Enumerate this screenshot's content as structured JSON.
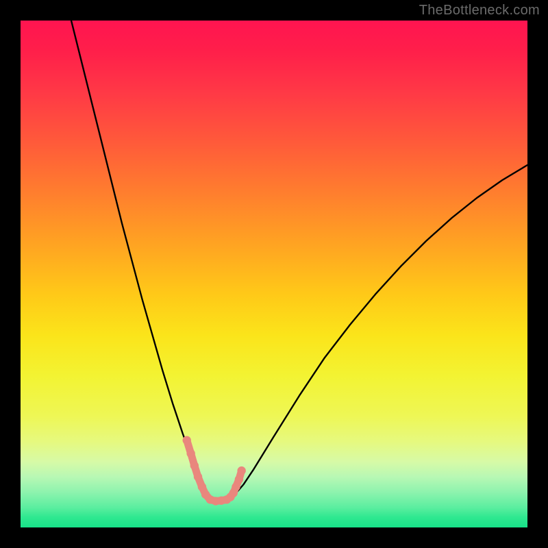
{
  "watermark": "TheBottleneck.com",
  "chart_data": {
    "type": "line",
    "title": "",
    "xlabel": "",
    "ylabel": "",
    "xlim": [
      0,
      100
    ],
    "ylim": [
      0,
      100
    ],
    "grid": false,
    "series": [
      {
        "name": "bottleneck-curve",
        "color": "#000000",
        "x": [
          10,
          12,
          14,
          16,
          18,
          20,
          22,
          24,
          26,
          28,
          30,
          32,
          34,
          36,
          37.4,
          40.7,
          42,
          44,
          46,
          50,
          55,
          60,
          65,
          70,
          75,
          80,
          85,
          90,
          95,
          100
        ],
        "y": [
          100,
          92,
          84,
          76,
          68,
          60,
          52.5,
          45,
          38,
          31,
          24.5,
          18.5,
          13,
          8,
          5.5,
          5.5,
          6.2,
          8.5,
          11.5,
          18,
          26,
          33.5,
          40,
          46,
          51.5,
          56.5,
          61,
          65,
          68.5,
          71.5
        ]
      },
      {
        "name": "bottleneck-marker-band",
        "color": "#e9877d",
        "x": [
          32.8,
          33.6,
          34.3,
          35.0,
          35.8,
          36.5,
          37.4,
          38.5,
          39.6,
          40.7,
          41.4,
          42.0,
          42.5,
          43.1,
          43.6
        ],
        "y": [
          17.2,
          14.6,
          12.2,
          10.0,
          8.0,
          6.5,
          5.5,
          5.2,
          5.3,
          5.5,
          6.0,
          6.8,
          8.0,
          9.5,
          11.2
        ]
      }
    ],
    "annotations": []
  },
  "colors": {
    "frame_background": "#000000",
    "curve": "#000000",
    "marker_band": "#e9877d",
    "watermark": "#6b6b6b"
  }
}
